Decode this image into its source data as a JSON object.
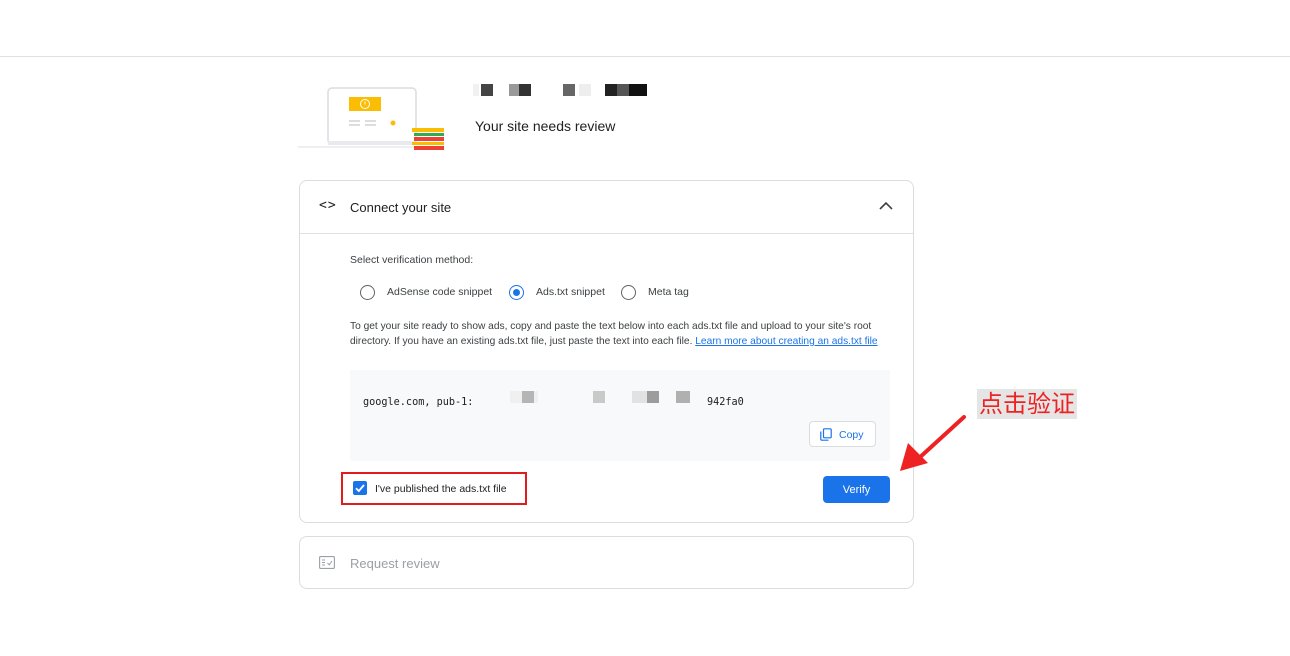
{
  "header": {
    "site_status": "Your site needs review"
  },
  "connect_card": {
    "title": "Connect your site",
    "method_label": "Select verification method:",
    "methods": [
      {
        "label": "AdSense code snippet",
        "selected": false
      },
      {
        "label": "Ads.txt snippet",
        "selected": true
      },
      {
        "label": "Meta tag",
        "selected": false
      }
    ],
    "instructions_text": "To get your site ready to show ads, copy and paste the text below into each ads.txt file and upload to your site's root directory. If you have an existing ads.txt file, just paste the text into each file. ",
    "instructions_link": "Learn more about creating an ads.txt file",
    "snippet_prefix": "google.com, pub-1:",
    "snippet_suffix": "942fa0",
    "copy_label": "Copy",
    "published_checkbox_label": "I've published the ads.txt file",
    "published_checked": true,
    "verify_label": "Verify"
  },
  "review_card": {
    "title": "Request review"
  },
  "annotation": {
    "text": "点击验证"
  },
  "colors": {
    "primary": "#1a73e8",
    "annotation_red": "#e01c1c",
    "warning_yellow": "#fbbc04"
  }
}
